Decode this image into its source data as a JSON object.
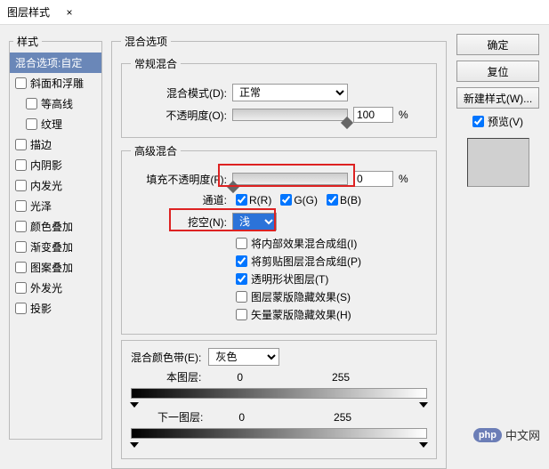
{
  "window": {
    "title": "图层样式",
    "close": "×"
  },
  "sidebar": {
    "legend": "样式",
    "items": [
      {
        "label": "混合选项:自定",
        "selected": true,
        "checkbox": false,
        "indent": false
      },
      {
        "label": "斜面和浮雕",
        "selected": false,
        "checkbox": true,
        "indent": false
      },
      {
        "label": "等高线",
        "selected": false,
        "checkbox": true,
        "indent": true
      },
      {
        "label": "纹理",
        "selected": false,
        "checkbox": true,
        "indent": true
      },
      {
        "label": "描边",
        "selected": false,
        "checkbox": true,
        "indent": false
      },
      {
        "label": "内阴影",
        "selected": false,
        "checkbox": true,
        "indent": false
      },
      {
        "label": "内发光",
        "selected": false,
        "checkbox": true,
        "indent": false
      },
      {
        "label": "光泽",
        "selected": false,
        "checkbox": true,
        "indent": false
      },
      {
        "label": "颜色叠加",
        "selected": false,
        "checkbox": true,
        "indent": false
      },
      {
        "label": "渐变叠加",
        "selected": false,
        "checkbox": true,
        "indent": false
      },
      {
        "label": "图案叠加",
        "selected": false,
        "checkbox": true,
        "indent": false
      },
      {
        "label": "外发光",
        "selected": false,
        "checkbox": true,
        "indent": false
      },
      {
        "label": "投影",
        "selected": false,
        "checkbox": true,
        "indent": false
      }
    ]
  },
  "main_legend": "混合选项",
  "general": {
    "legend": "常规混合",
    "blendmode_label": "混合模式(D):",
    "blendmode_value": "正常",
    "opacity_label": "不透明度(O):",
    "opacity_value": "100",
    "opacity_unit": "%"
  },
  "advanced": {
    "legend": "高级混合",
    "fill_label": "填充不透明度(F):",
    "fill_value": "0",
    "fill_unit": "%",
    "channel_label": "通道:",
    "ch_r": "R(R)",
    "ch_g": "G(G)",
    "ch_b": "B(B)",
    "knockout_label": "挖空(N):",
    "knockout_value": "浅",
    "chk1": "将内部效果混合成组(I)",
    "chk2": "将剪贴图层混合成组(P)",
    "chk3": "透明形状图层(T)",
    "chk4": "图层蒙版隐藏效果(S)",
    "chk5": "矢量蒙版隐藏效果(H)"
  },
  "blendif": {
    "legend": "混合颜色带(E):",
    "mode": "灰色",
    "this_label": "本图层:",
    "this_low": "0",
    "this_high": "255",
    "under_label": "下一图层:",
    "under_low": "0",
    "under_high": "255"
  },
  "right": {
    "ok": "确定",
    "reset": "复位",
    "newstyle": "新建样式(W)...",
    "preview": "预览(V)"
  },
  "watermark": {
    "badge": "php",
    "text": "中文网"
  }
}
